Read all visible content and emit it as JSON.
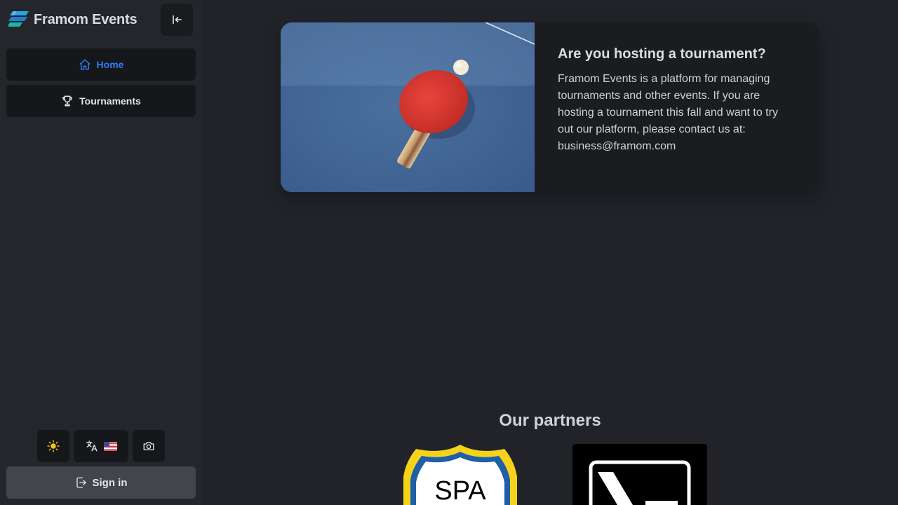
{
  "brand": {
    "name": "Framom Events",
    "logo_icon": "framom-logo-icon"
  },
  "sidebar": {
    "collapse_icon": "collapse-left-icon",
    "nav": [
      {
        "label": "Home",
        "icon": "home-icon",
        "active": true
      },
      {
        "label": "Tournaments",
        "icon": "trophy-icon",
        "active": false
      }
    ],
    "tools": [
      {
        "icon": "sun-icon"
      },
      {
        "icon": "translate-icon",
        "flag": "us-flag"
      },
      {
        "icon": "camera-icon"
      }
    ],
    "signin_label": "Sign in"
  },
  "hero": {
    "title": "Are you hosting a tournament?",
    "body": "Framom Events is a platform for managing tournaments and other events. If you are hosting a tournament this fall and want to try out our platform, please contact us at:",
    "email": "business@framom.com"
  },
  "partners": {
    "title": "Our partners",
    "items": [
      {
        "name": "SPA"
      },
      {
        "name": "X"
      }
    ]
  },
  "colors": {
    "accent": "#2e7cf6",
    "background": "#212329",
    "sidebar": "#25262b"
  }
}
